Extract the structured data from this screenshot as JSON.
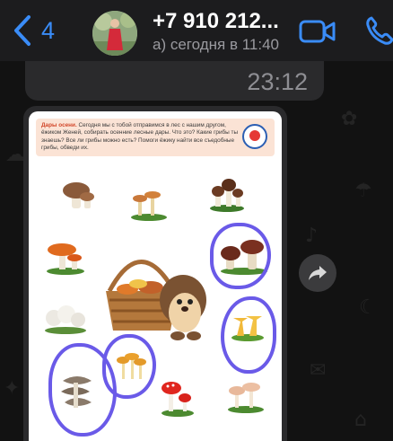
{
  "header": {
    "back_count": "4",
    "contact_name": "+7 910 212...",
    "status": "а) сегодня в 11:40"
  },
  "messages": {
    "previous_time": "23:12"
  },
  "worksheet": {
    "title": "Дары осени.",
    "intro": " Сегодня мы с тобой отправимся в лес с нашим другом, ёжиком Женей, собирать осенние лесные дары. Что это? Какие грибы ты знаешь? Все ли грибы можно есть? Помоги ёжику найти все съедобные грибы, обведи их."
  },
  "colors": {
    "accent": "#3a8cf7",
    "circle": "#6a5ae8",
    "bubble": "#2a2a2c",
    "header_bg": "#1c1c1e"
  },
  "icons": [
    "back-chevron-icon",
    "video-call-icon",
    "phone-icon",
    "forward-icon"
  ]
}
